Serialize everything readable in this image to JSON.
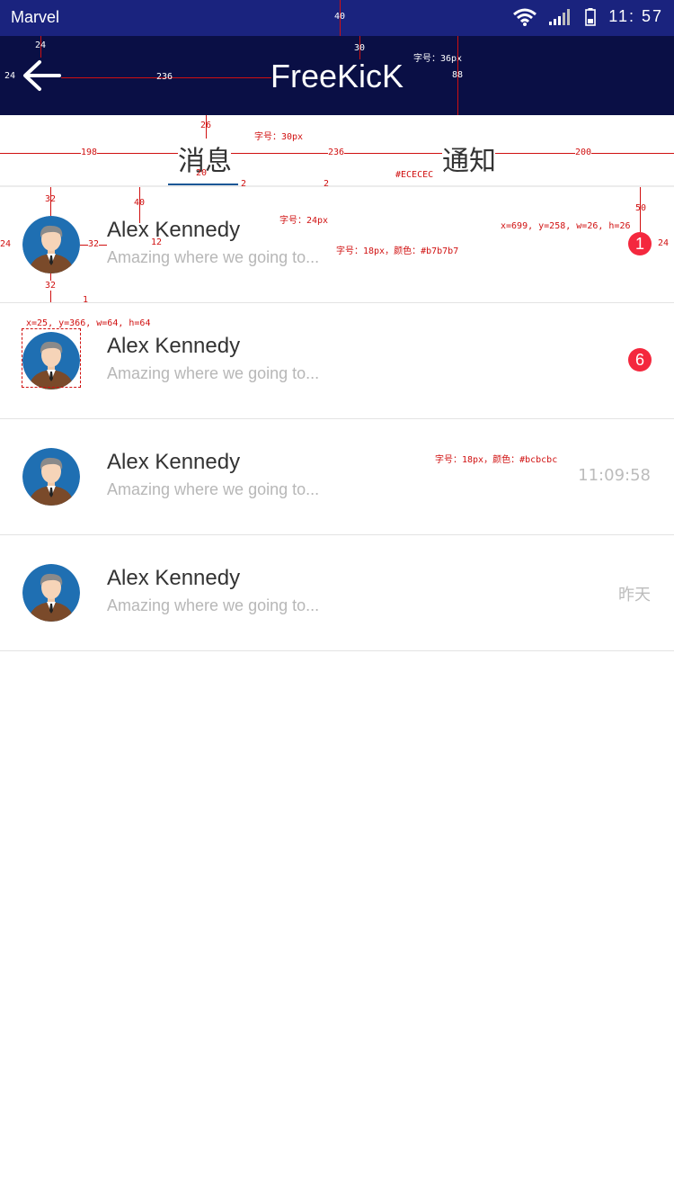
{
  "status_bar": {
    "carrier": "Marvel",
    "time": "11: 57"
  },
  "nav": {
    "title": "FreeKicK"
  },
  "tabs": [
    {
      "label": "消息",
      "active": true
    },
    {
      "label": "通知",
      "active": false
    }
  ],
  "list": [
    {
      "name": "Alex Kennedy",
      "preview": "Amazing where we going to...",
      "badge": "1",
      "meta": ""
    },
    {
      "name": "Alex Kennedy",
      "preview": "Amazing where we going to...",
      "badge": "6",
      "meta": ""
    },
    {
      "name": "Alex Kennedy",
      "preview": "Amazing where we going to...",
      "badge": "",
      "meta": "11:09:58"
    },
    {
      "name": "Alex Kennedy",
      "preview": "Amazing where we going to...",
      "badge": "",
      "meta": "昨天"
    }
  ],
  "annotations": {
    "a40": "40",
    "a24_top": "24",
    "a24_left": "24",
    "a236_back": "236",
    "a30": "30",
    "title_font": "字号：36px",
    "a88": "88",
    "a26": "26",
    "tab_font": "字号：30px",
    "a198": "198",
    "a236_tabs": "236",
    "a200": "200",
    "a20": "20",
    "a2_a": "2",
    "a2_b": "2",
    "divider_color": "#ECECEC",
    "a32_top": "32",
    "a40_b": "40",
    "name_font": "字号：24px",
    "preview_font": "字号：18px，颜色：#b7b7b7",
    "badge_box": "x=699, y=258, w=26, h=26",
    "a50": "50",
    "a24_row": "24",
    "a32_mid": "32",
    "a12": "12",
    "a24_right": "24",
    "a32_bottom": "32",
    "a1": "1",
    "avatar_box": "x=25, y=366, w=64, h=64",
    "meta_font": "字号：18px，颜色：#bcbcbc"
  },
  "colors": {
    "status_bar_bg": "#1a237e",
    "nav_bg": "#0a0f45",
    "tab_indicator": "#1a5796",
    "divider": "#ECECEC",
    "badge": "#f4283e",
    "preview_text": "#b7b7b7",
    "meta_text": "#bcbcbc"
  },
  "icons": [
    "wifi-icon",
    "signal-icon",
    "battery-icon",
    "back-arrow-icon",
    "avatar-icon"
  ]
}
